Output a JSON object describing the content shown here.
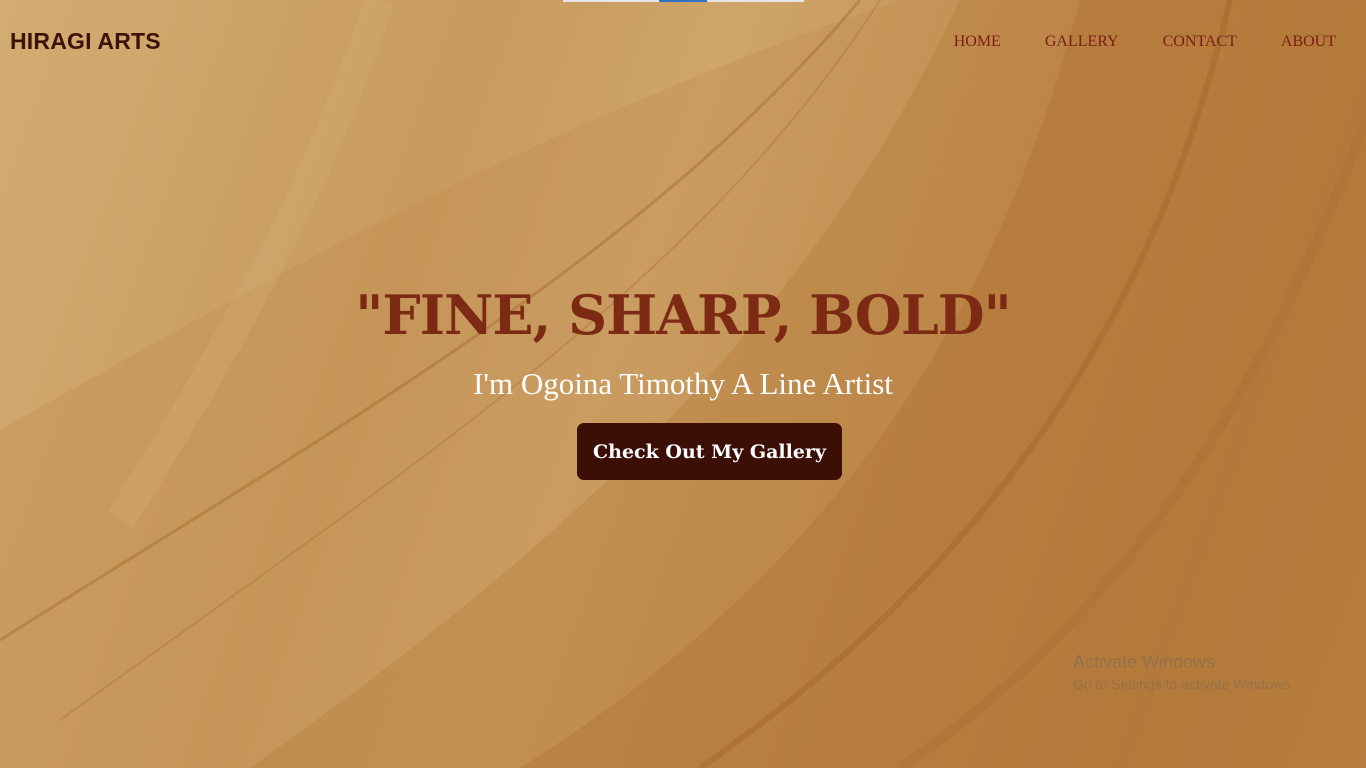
{
  "browser": {
    "loading_bar_color": "#2f73c4"
  },
  "header": {
    "brand": "HIRAGI ARTS",
    "nav": [
      {
        "label": "HOME"
      },
      {
        "label": "GALLERY"
      },
      {
        "label": "CONTACT"
      },
      {
        "label": "ABOUT"
      }
    ]
  },
  "hero": {
    "title": "\"FINE, SHARP, BOLD\"",
    "subtitle": "I'm Ogoina Timothy A Line Artist",
    "cta_label": "Check Out My Gallery"
  },
  "os_overlay": {
    "line1": "Activate Windows",
    "line2": "Go to Settings to activate Windows."
  },
  "colors": {
    "brand": "#3b1206",
    "nav": "#7c1c14",
    "title": "#7d2a14",
    "button": "#3b0e06"
  }
}
